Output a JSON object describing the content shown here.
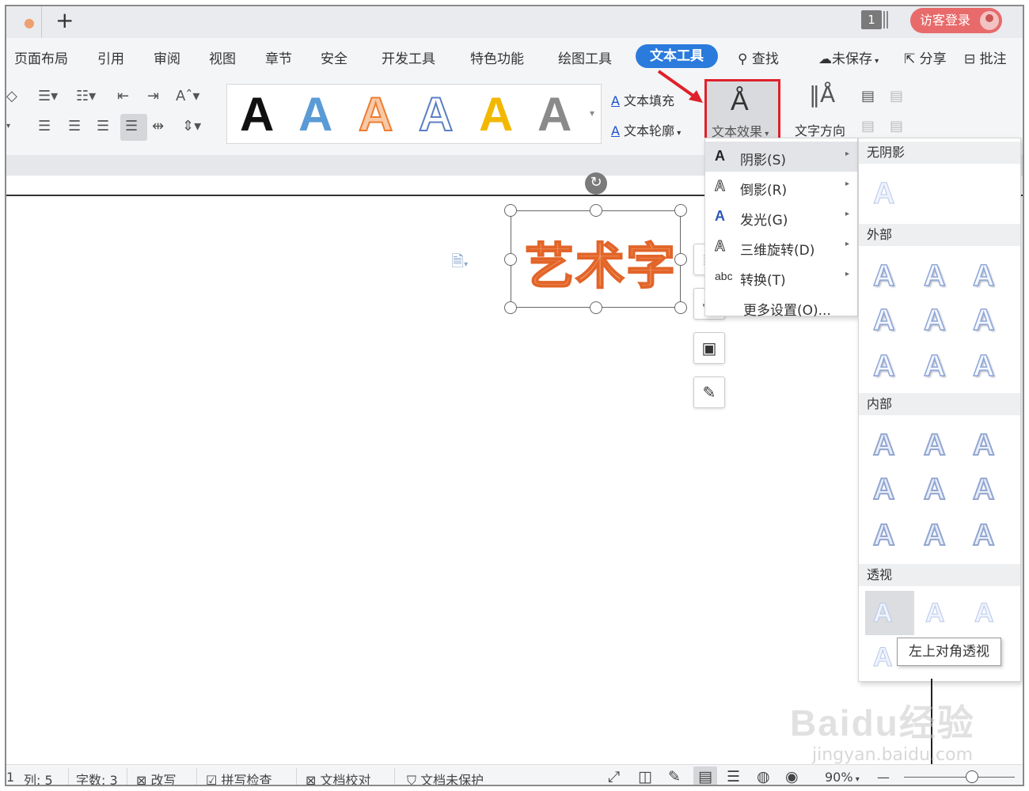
{
  "titlebar": {
    "tab_dot": "●",
    "new_tab": "+",
    "window_count": "1",
    "login_label": "访客登录"
  },
  "menubar": {
    "items": [
      "页面布局",
      "引用",
      "审阅",
      "视图",
      "章节",
      "安全",
      "开发工具",
      "特色功能",
      "绘图工具"
    ],
    "active": "文本工具",
    "search": "查找",
    "unsaved": "未保存",
    "share": "分享",
    "comment": "批注"
  },
  "ribbon": {
    "gallery_letters": [
      "A",
      "A",
      "A",
      "A",
      "A",
      "A"
    ],
    "text_fill": "文本填充",
    "text_outline": "文本轮廓",
    "text_effect": "文本效果",
    "text_direction": "文字方向",
    "colors": {
      "black": "#111111",
      "blue": "#5b9bd5",
      "orange": "#ed7d31",
      "gold": "#f2b800",
      "gray": "#7f7f7f",
      "accent_red": "#e0202a"
    }
  },
  "document": {
    "art_text": "艺术字"
  },
  "effect_menu": {
    "items": [
      {
        "icon": "A",
        "label": "阴影(S)",
        "has_sub": true
      },
      {
        "icon": "A",
        "label": "倒影(R)",
        "has_sub": true
      },
      {
        "icon": "A",
        "label": "发光(G)",
        "has_sub": true
      },
      {
        "icon": "A",
        "label": "三维旋转(D)",
        "has_sub": true
      },
      {
        "icon": "abc",
        "label": "转换(T)",
        "has_sub": true
      }
    ],
    "more": "更多设置(O)..."
  },
  "shadow_panel": {
    "no_shadow": "无阴影",
    "outer": "外部",
    "inner": "内部",
    "perspective": "透视",
    "tooltip": "左上对角透视",
    "letter": "A"
  },
  "statusbar": {
    "page": "1",
    "col": "列: 5",
    "words": "字数: 3",
    "overwrite": "改写",
    "spellcheck": "拼写检查",
    "proofread": "文档校对",
    "protect": "文档未保护",
    "zoom": "90%",
    "zoom_minus": "—"
  },
  "watermark": {
    "brand": "Baidu经验",
    "url": "jingyan.baidu.com"
  }
}
